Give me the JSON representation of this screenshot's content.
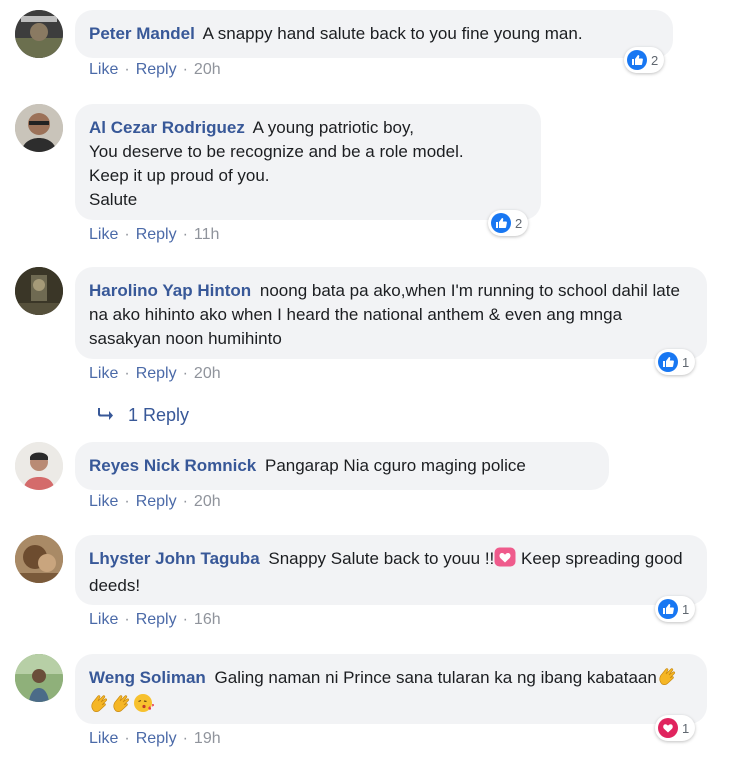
{
  "comments": [
    {
      "author": "Peter Mandel",
      "text": "A snappy hand salute back to you fine young man.",
      "like": "Like",
      "reply": "Reply",
      "time": "20h",
      "reaction_type": "like-icon",
      "reaction_count": "2"
    },
    {
      "author": "Al Cezar Rodriguez",
      "text": "A young patriotic boy,\nYou deserve to be recognize and be a role model.\nKeep it up proud of you.\nSalute",
      "like": "Like",
      "reply": "Reply",
      "time": "11h",
      "reaction_type": "like-icon",
      "reaction_count": "2"
    },
    {
      "author": "Harolino Yap Hinton",
      "text": "noong bata pa ako,when I'm running to school dahil late na ako hihinto ako when I heard the national anthem & even ang mnga sasakyan noon humihinto",
      "like": "Like",
      "reply": "Reply",
      "time": "20h",
      "reaction_type": "like-icon",
      "reaction_count": "1"
    },
    {
      "author": "Reyes Nick Romnick",
      "text": "Pangarap Nia cguro maging police",
      "like": "Like",
      "reply": "Reply",
      "time": "20h"
    },
    {
      "author": "Lhyster John Taguba",
      "text_before": "Snappy Salute back to youu !!",
      "text_after": " Keep spreading good deeds!",
      "like": "Like",
      "reply": "Reply",
      "time": "16h",
      "reaction_type": "like-icon",
      "reaction_count": "1"
    },
    {
      "author": "Weng Soliman",
      "text": "Galing naman ni Prince sana tularan ka ng ibang kabataan",
      "like": "Like",
      "reply": "Reply",
      "time": "19h",
      "reaction_type": "heart-icon",
      "reaction_count": "1"
    }
  ],
  "replies_link": {
    "label": "1 Reply",
    "icon": "reply-arrow-icon"
  },
  "colors": {
    "author": "#385898",
    "meta_link": "#4b6aa8",
    "bubble": "#f2f3f5",
    "like_blue": "#1877f2",
    "love_red": "#e0245e"
  }
}
